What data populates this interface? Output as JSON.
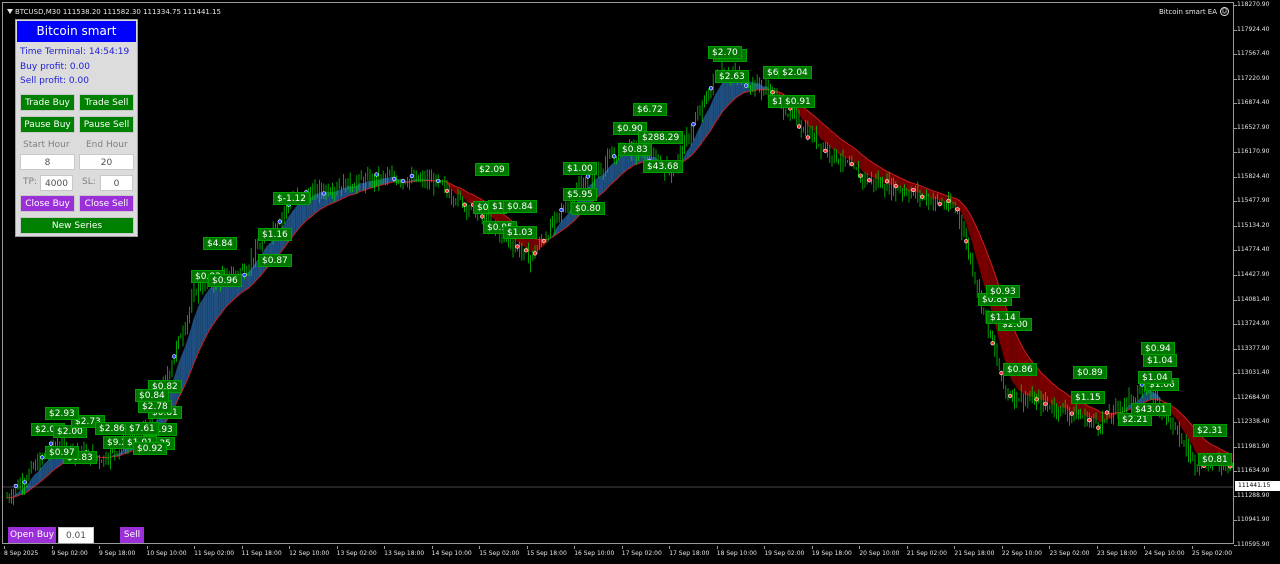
{
  "header": {
    "symbol_info": "BTCUSD,M30  111538.20 111582.30 111334.75 111441.15",
    "ea_name": "Bitcoin smart EA",
    "smiley": "☺"
  },
  "price_axis": {
    "ticks": [
      "118270.90",
      "117924.40",
      "117567.40",
      "117220.90",
      "116874.40",
      "116527.90",
      "116170.90",
      "115824.40",
      "115477.90",
      "115134.20",
      "114774.40",
      "114427.90",
      "114081.40",
      "113724.90",
      "113377.90",
      "113031.40",
      "112684.90",
      "112338.40",
      "111981.90",
      "111634.90",
      "111288.90",
      "110941.90",
      "110595.90"
    ],
    "current_price": "111441.15"
  },
  "time_axis": {
    "ticks": [
      "8 Sep 2025",
      "9 Sep 02:00",
      "9 Sep 18:00",
      "10 Sep 10:00",
      "11 Sep 02:00",
      "11 Sep 18:00",
      "12 Sep 10:00",
      "13 Sep 02:00",
      "13 Sep 18:00",
      "14 Sep 10:00",
      "15 Sep 02:00",
      "15 Sep 18:00",
      "16 Sep 10:00",
      "17 Sep 02:00",
      "17 Sep 18:00",
      "18 Sep 10:00",
      "19 Sep 02:00",
      "19 Sep 18:00",
      "20 Sep 10:00",
      "21 Sep 02:00",
      "21 Sep 18:00",
      "22 Sep 10:00",
      "23 Sep 02:00",
      "23 Sep 18:00",
      "24 Sep 10:00",
      "25 Sep 02:00"
    ]
  },
  "panel": {
    "title": "Bitcoin smart",
    "time_terminal": "Time Terminal: 14:54:19",
    "buy_profit": "Buy profit: 0.00",
    "sell_profit": "Sell profit: 0.00",
    "trade_buy": "Trade Buy",
    "trade_sell": "Trade Sell",
    "pause_buy": "Pause Buy",
    "pause_sell": "Pause Sell",
    "start_hour_label": "Start Hour",
    "end_hour_label": "End Hour",
    "start_hour_value": "8",
    "end_hour_value": "20",
    "tp_label": "TP:",
    "tp_value": "4000",
    "sl_label": "SL:",
    "sl_value": "0",
    "close_buy": "Close Buy",
    "close_sell": "Close Sell",
    "new_series": "New Series"
  },
  "bottom_bar": {
    "open_buy": "Open Buy",
    "lot_value": "0.01",
    "open_sell": "Sell"
  },
  "colors": {
    "background": "#000000",
    "candle": "#00c800",
    "bull_cloud": "#1f4f80",
    "bear_cloud": "#7a0000",
    "fast_line": "#c81e1e",
    "profit_label": "#007800",
    "panel_title": "#0000ff",
    "button_green": "#008000",
    "button_purple": "#9b30d9"
  },
  "chart_data": {
    "type": "line",
    "symbol": "BTCUSD",
    "timeframe": "M30",
    "x": [
      "8 Sep 2025",
      "9 Sep 02:00",
      "9 Sep 18:00",
      "10 Sep 10:00",
      "11 Sep 02:00",
      "11 Sep 18:00",
      "12 Sep 10:00",
      "13 Sep 02:00",
      "13 Sep 18:00",
      "14 Sep 10:00",
      "15 Sep 02:00",
      "15 Sep 18:00",
      "16 Sep 10:00",
      "17 Sep 02:00",
      "17 Sep 18:00",
      "18 Sep 10:00",
      "19 Sep 02:00",
      "19 Sep 18:00",
      "20 Sep 10:00",
      "21 Sep 02:00",
      "21 Sep 18:00",
      "22 Sep 10:00",
      "23 Sep 02:00",
      "23 Sep 18:00",
      "24 Sep 10:00",
      "25 Sep 02:00"
    ],
    "series": [
      {
        "values": [
          111300,
          112050,
          111850,
          112300,
          114300,
          114550,
          115550,
          115750,
          115850,
          115800,
          115300,
          114700,
          115700,
          116300,
          115950,
          117400,
          117100,
          116400,
          115850,
          115650,
          115400,
          112800,
          112600,
          112350,
          112900,
          111800
        ]
      }
    ],
    "ylim": [
      110595.9,
      118270.9
    ],
    "grid": false,
    "profit_labels": [
      "$2.01",
      "$2.00",
      "$0.83",
      "$2.73",
      "$0.97",
      "$2.93",
      "$9.24",
      "$0.89",
      "$2.86",
      "$0.93",
      "$0.82",
      "$0.81",
      "$1.35",
      "$2.78",
      "$1.01",
      "$0.84",
      "$7.61",
      "$0.92",
      "$0.83",
      "$0.96",
      "$4.84",
      "$1.16",
      "$0.87",
      "$-1.12",
      "$0.92",
      "$2.09",
      "$18.08",
      "$0.95",
      "$0.84",
      "$1.03",
      "$1.00",
      "$5.95",
      "$0.80",
      "$0.90",
      "$0.83",
      "$6.72",
      "$288.29",
      "$43.68",
      "$0.84",
      "$2.63",
      "$2.70",
      "$6.95",
      "$1.46",
      "$2.04",
      "$0.91",
      "$2.00",
      "$0.86",
      "$0.83",
      "$0.93",
      "$1.14",
      "$0.89",
      "$1.15",
      "$2.21",
      "$1.04",
      "$1.06",
      "$0.94",
      "$1.04",
      "$43.01",
      "$2.31",
      "$0.81"
    ]
  }
}
